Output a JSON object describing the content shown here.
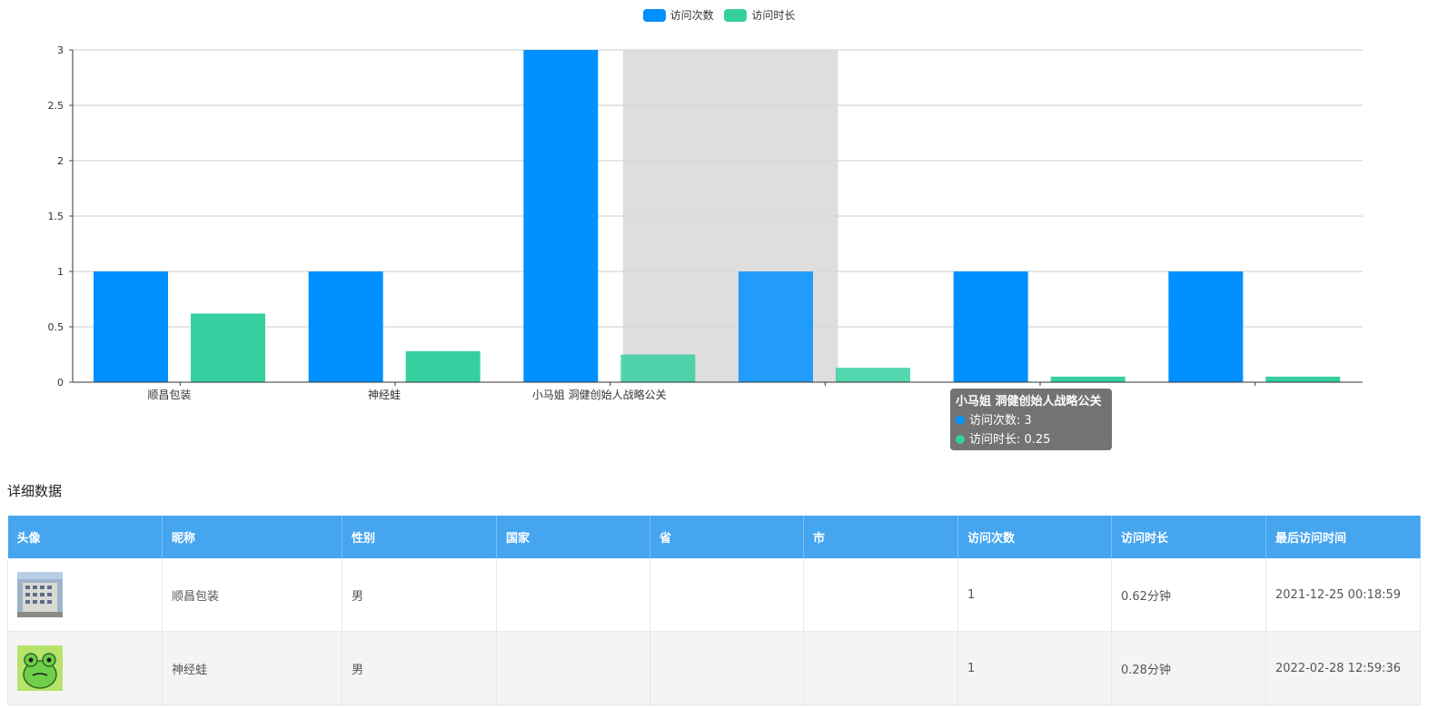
{
  "colors": {
    "series1": "#0090ff",
    "series2": "#36cfa0",
    "header_bg": "#45a5ef"
  },
  "chart_data": {
    "type": "bar",
    "legend_placement": "top-center",
    "grid": true,
    "ylim": [
      0,
      3
    ],
    "y_ticks": [
      "0",
      "0.5",
      "1",
      "1.5",
      "2",
      "2.5",
      "3"
    ],
    "categories": [
      "顺昌包装",
      "神经蛙",
      "小马姐 洞健创始人战略公关",
      "",
      "",
      ""
    ],
    "series": [
      {
        "name": "访问次数",
        "color": "#0090ff",
        "values": [
          1,
          1,
          3,
          1,
          1,
          1
        ]
      },
      {
        "name": "访问时长",
        "color": "#36cfa0",
        "values": [
          0.62,
          0.28,
          0.25,
          0.13,
          0.05,
          0.05
        ]
      }
    ],
    "highlighted_category_index": 3,
    "tooltip": {
      "title": "小马姐 洞健创始人战略公关",
      "lines": [
        "访问次数: 3",
        "访问时长: 0.25"
      ]
    }
  },
  "table": {
    "section_title": "详细数据",
    "headers": [
      "头像",
      "昵称",
      "性别",
      "国家",
      "省",
      "市",
      "访问次数",
      "访问时长",
      "最后访问时间"
    ],
    "rows": [
      {
        "avatar": "building-avatar",
        "nickname": "顺昌包装",
        "gender": "男",
        "country": "",
        "province": "",
        "city": "",
        "visits": "1",
        "duration": "0.62分钟",
        "last_visit": "2021-12-25 00:18:59"
      },
      {
        "avatar": "frog-avatar",
        "nickname": "神经蛙",
        "gender": "男",
        "country": "",
        "province": "",
        "city": "",
        "visits": "1",
        "duration": "0.28分钟",
        "last_visit": "2022-02-28 12:59:36"
      }
    ]
  }
}
